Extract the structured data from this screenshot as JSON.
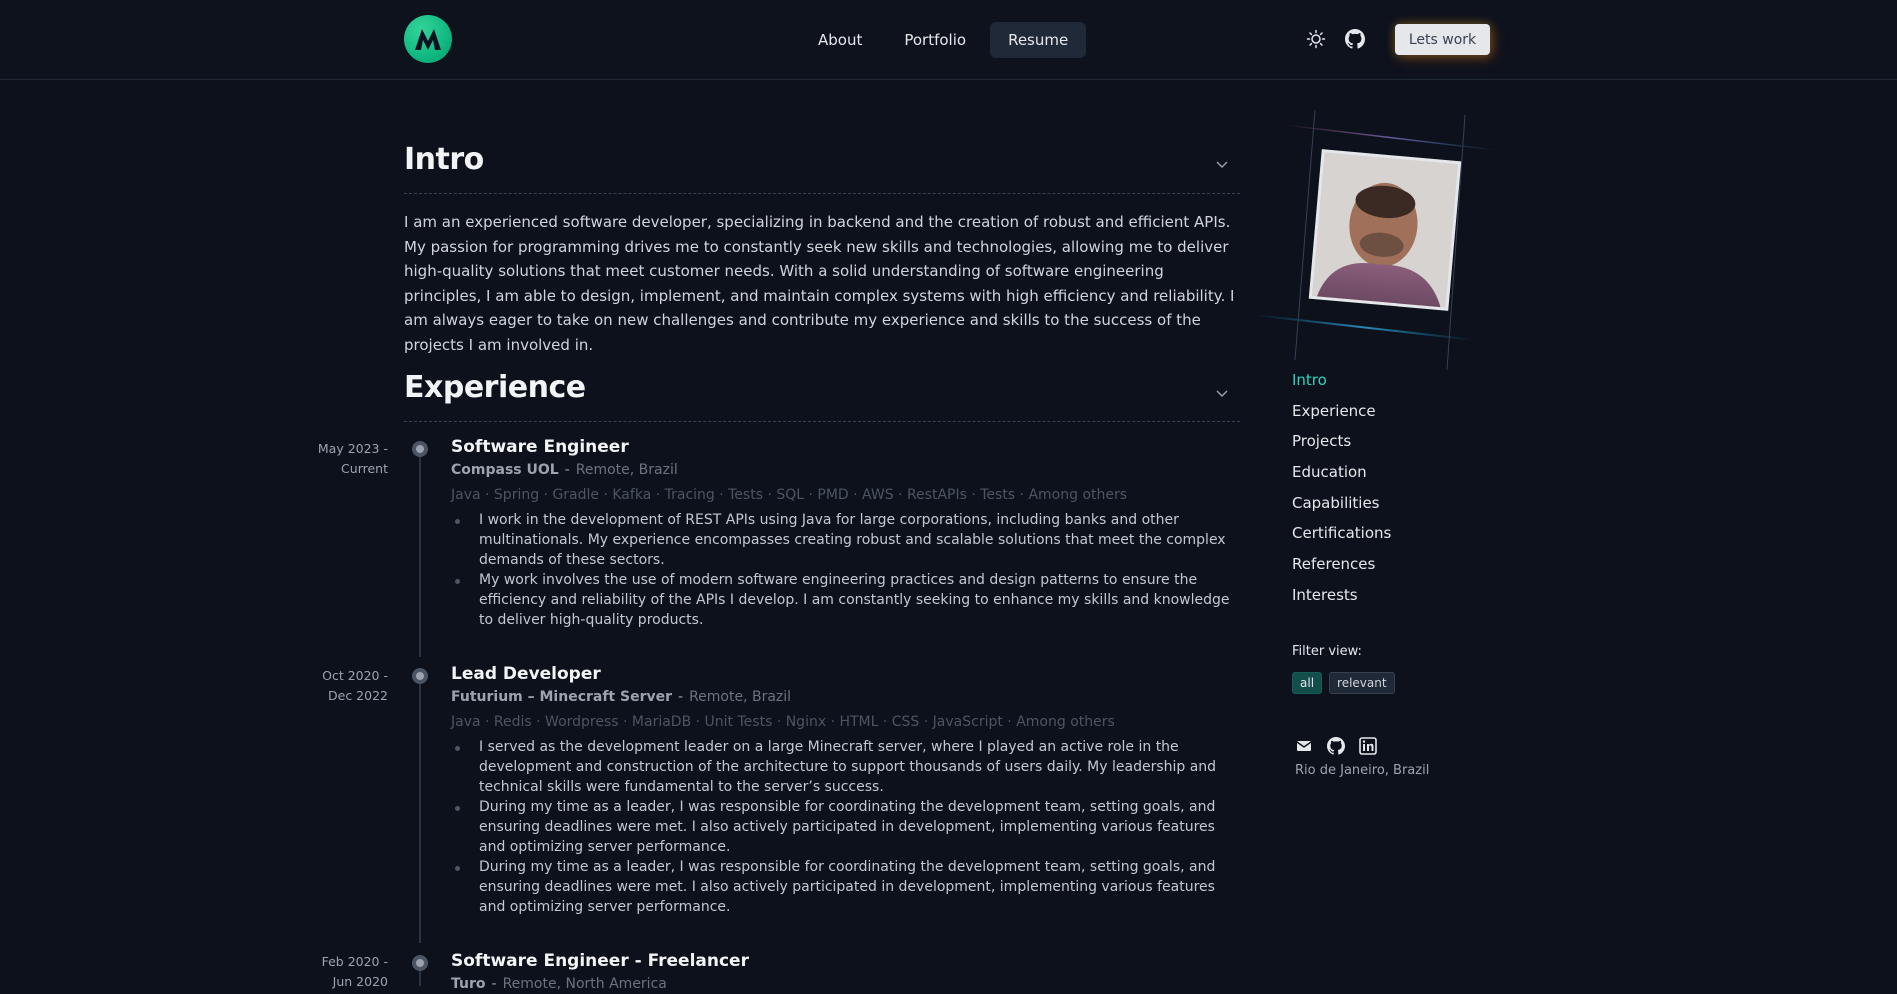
{
  "header": {
    "nav": [
      "About",
      "Portfolio",
      "Resume"
    ],
    "active_nav": "Resume",
    "cta_label": "Lets work"
  },
  "intro": {
    "title": "Intro",
    "text": "I am an experienced software developer, specializing in backend and the creation of robust and efficient APIs. My passion for programming drives me to constantly seek new skills and technologies, allowing me to deliver high-quality solutions that meet customer needs. With a solid understanding of software engineering principles, I am able to design, implement, and maintain complex systems with high efficiency and reliability. I am always eager to take on new challenges and contribute my experience and skills to the success of the projects I am involved in."
  },
  "experience": {
    "title": "Experience",
    "jobs": [
      {
        "date_start": "May 2023 -",
        "date_end": "Current",
        "title": "Software Engineer",
        "company": "Compass UOL",
        "location": "Remote, Brazil",
        "tech": "Java · Spring · Gradle · Kafka · Tracing · Tests · SQL · PMD · AWS · RestAPIs · Tests · Among others",
        "bullets": [
          "I work in the development of REST APIs using Java for large corporations, including banks and other multinationals. My experience encompasses creating robust and scalable solutions that meet the complex demands of these sectors.",
          "My work involves the use of modern software engineering practices and design patterns to ensure the efficiency and reliability of the APIs I develop. I am constantly seeking to enhance my skills and knowledge to deliver high-quality products."
        ]
      },
      {
        "date_start": "Oct 2020 -",
        "date_end": "Dec 2022",
        "title": "Lead Developer",
        "company": "Futurium – Minecraft Server",
        "location": "Remote, Brazil",
        "tech": "Java · Redis · Wordpress · MariaDB · Unit Tests · Nginx · HTML · CSS · JavaScript · Among others",
        "bullets": [
          "I served as the development leader on a large Minecraft server, where I played an active role in the development and construction of the architecture to support thousands of users daily. My leadership and technical skills were fundamental to the server’s success.",
          "During my time as a leader, I was responsible for coordinating the development team, setting goals, and ensuring deadlines were met. I also actively participated in development, implementing various features and optimizing server performance.",
          "During my time as a leader, I was responsible for coordinating the development team, setting goals, and ensuring deadlines were met. I also actively participated in development, implementing various features and optimizing server performance."
        ]
      },
      {
        "date_start": "Feb 2020 -",
        "date_end": "Jun 2020",
        "title": "Software Engineer - Freelancer",
        "company": "Turo",
        "location": "Remote, North America"
      }
    ]
  },
  "sidebar": {
    "toc": [
      "Intro",
      "Experience",
      "Projects",
      "Education",
      "Capabilities",
      "Certifications",
      "References",
      "Interests"
    ],
    "filter_label": "Filter view:",
    "filters": [
      "all",
      "relevant"
    ],
    "location": "Rio de Janeiro, Brazil"
  },
  "colors": {
    "accent": "#2dd4bf",
    "background": "#0d111b",
    "logo": "#10b981"
  }
}
